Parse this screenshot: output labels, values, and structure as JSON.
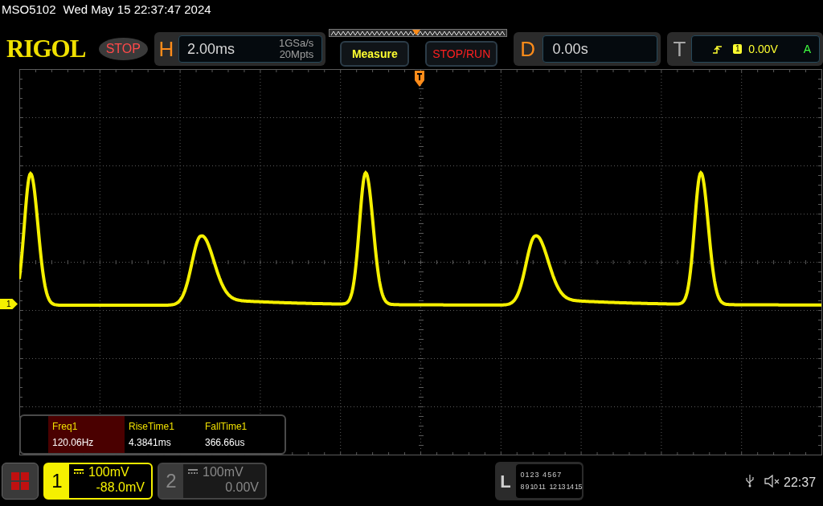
{
  "status_line": {
    "model": "MSO5102",
    "datetime": "Wed May 15 22:37:47 2024"
  },
  "brand": "RIGOL",
  "run_state": {
    "label": "STOP",
    "kind": "stop"
  },
  "horizontal": {
    "letter": "H",
    "timebase": "2.00ms",
    "sample_rate": "1GSa/s",
    "memory_depth": "20Mpts"
  },
  "buttons": [
    {
      "label": "Measure",
      "kind": "measure"
    },
    {
      "label": "STOP/RUN",
      "kind": "run"
    }
  ],
  "delay": {
    "letter": "D",
    "value": "0.00s"
  },
  "trigger": {
    "letter": "T",
    "source": "1",
    "level": "0.00V",
    "mode": "A"
  },
  "trace_marker": "1",
  "measurements": [
    {
      "name": "Freq1",
      "value": "120.06Hz",
      "selected": true
    },
    {
      "name": "RiseTime1",
      "value": "4.3841ms",
      "selected": false
    },
    {
      "name": "FallTime1",
      "value": "366.66us",
      "selected": false
    }
  ],
  "channels": [
    {
      "number": "1",
      "scale": "100mV",
      "offset": "-88.0mV",
      "selected": true
    },
    {
      "number": "2",
      "scale": "100mV",
      "offset": "0.00V",
      "selected": false
    }
  ],
  "logic": {
    "letter": "L",
    "row_1": [
      "0",
      "1",
      "2",
      "3",
      "4",
      "5",
      "6",
      "7"
    ],
    "row_2": [
      "8",
      "9",
      "10",
      "11",
      "12",
      "13",
      "14",
      "15"
    ]
  },
  "clock": "22:37"
}
